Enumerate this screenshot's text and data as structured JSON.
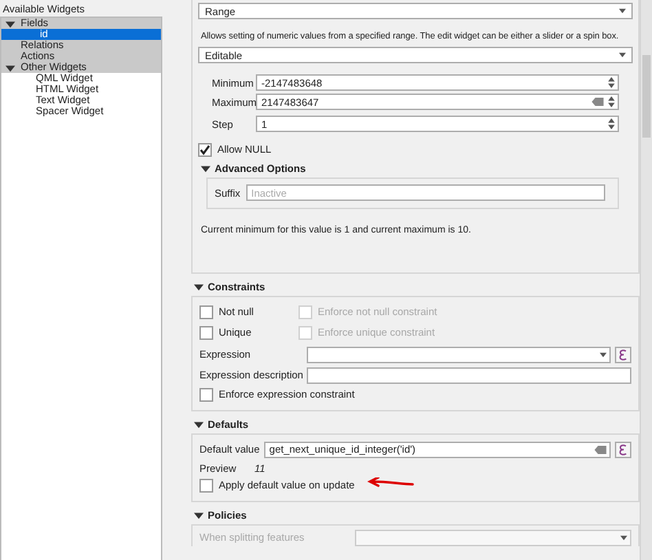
{
  "tree": {
    "header": "Available Widgets",
    "items": [
      {
        "label": "Fields",
        "kind": "category",
        "selected": false,
        "expanded": true,
        "children": [
          {
            "label": "id",
            "kind": "field",
            "selected": true
          }
        ]
      },
      {
        "label": "Relations",
        "kind": "category",
        "selected": false
      },
      {
        "label": "Actions",
        "kind": "category",
        "selected": false
      },
      {
        "label": "Other Widgets",
        "kind": "category",
        "selected": false,
        "expanded": true,
        "children": [
          {
            "label": "QML Widget",
            "kind": "widget",
            "selected": false
          },
          {
            "label": "HTML Widget",
            "kind": "widget",
            "selected": false
          },
          {
            "label": "Text Widget",
            "kind": "widget",
            "selected": false
          },
          {
            "label": "Spacer Widget",
            "kind": "widget",
            "selected": false
          }
        ]
      }
    ]
  },
  "widget_type": {
    "value": "Range"
  },
  "description": "Allows setting of numeric values from a specified range. The edit widget can be either a slider or a spin box.",
  "mode": {
    "value": "Editable"
  },
  "range_fields": [
    {
      "label": "Minimum",
      "value": "-2147483648",
      "clearable": false
    },
    {
      "label": "Maximum",
      "value": "2147483647",
      "clearable": true
    },
    {
      "label": "Step",
      "value": "1",
      "clearable": false
    }
  ],
  "allow_null": {
    "label": "Allow NULL",
    "checked": true
  },
  "advanced": {
    "title": "Advanced Options",
    "expanded": true,
    "suffix": {
      "label": "Suffix",
      "placeholder": "Inactive"
    }
  },
  "range_note": "Current minimum for this value is 1 and current maximum is 10.",
  "constraints": {
    "title": "Constraints",
    "expanded": true,
    "checks": [
      {
        "label": "Not null",
        "checked": false,
        "disabled": false
      },
      {
        "label": "Enforce not null constraint",
        "checked": false,
        "disabled": true
      },
      {
        "label": "Unique",
        "checked": false,
        "disabled": false
      },
      {
        "label": "Enforce unique constraint",
        "checked": false,
        "disabled": true
      }
    ],
    "expression": {
      "label": "Expression"
    },
    "expression_description": {
      "label": "Expression description"
    },
    "enforce_expression": {
      "label": "Enforce expression constraint",
      "checked": false,
      "disabled": false
    }
  },
  "defaults": {
    "title": "Defaults",
    "expanded": true,
    "default_value": {
      "label": "Default value",
      "value": "get_next_unique_id_integer('id')"
    },
    "preview": {
      "label": "Preview",
      "value": "11"
    },
    "apply_on_update": {
      "label": "Apply default value on update",
      "checked": false,
      "disabled": false
    }
  },
  "policies": {
    "title": "Policies",
    "expanded": true,
    "split_policy": {
      "label": "When splitting features",
      "disabled": true
    }
  }
}
